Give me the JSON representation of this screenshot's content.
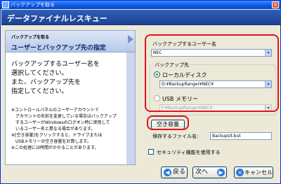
{
  "window": {
    "title": "バックアップを取る",
    "close_glyph": "×"
  },
  "banner": {
    "title": "データファイナルレスキュー"
  },
  "step": {
    "label": "バックアップを取る",
    "title": "ユーザーとバックアップ先の指定"
  },
  "description": [
    "バックアップするユーザー名を",
    "選択してください。",
    "また、バックアップ先を",
    "指定してください。"
  ],
  "notes": [
    "※コントロールパネルのユーザーアカウントで",
    "　アカウントの名前を変更している場合はバックアップ",
    "　するユーザーがWindowsのログオン時に使用して",
    "　いるユーザー名と異なる場合があります。",
    "※[空き容量]をクリックすると、ドライブまたは",
    "　USBメモリーの空き容量を計算します。",
    "※この処理には時間がかかることがあります。"
  ],
  "user": {
    "label": "バックアップするユーザー名",
    "selected": "NEC"
  },
  "dest": {
    "legend": "バックアップ先",
    "local_label": "ローカルディスク",
    "local_path": "D:¥BackupRanger¥NEC¥",
    "usb_label": "USB メモリー",
    "usb_path": "F:¥BackupRanger¥NEC¥"
  },
  "free_space_button": "空き容量",
  "filename": {
    "label": "保存するファイル名:",
    "value": "BackupUt.but"
  },
  "security_checkbox": "セキュリティ機能を使用する",
  "nav": {
    "back": "戻る",
    "next": "次へ",
    "cancel": "キャンセル"
  },
  "colors": {
    "highlight": "#e0141e",
    "banner": "#1d4294",
    "titlebar": "#0a55e0"
  }
}
